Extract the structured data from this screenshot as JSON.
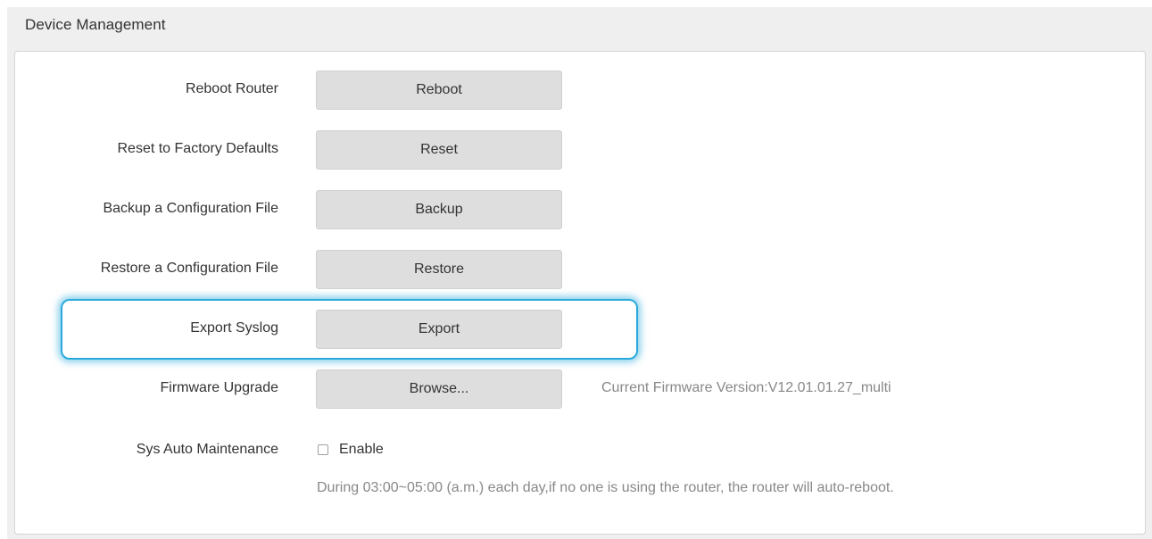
{
  "section": {
    "title": "Device Management"
  },
  "rows": {
    "reboot": {
      "label": "Reboot Router",
      "button": "Reboot"
    },
    "reset": {
      "label": "Reset to Factory Defaults",
      "button": "Reset"
    },
    "backup": {
      "label": "Backup a Configuration File",
      "button": "Backup"
    },
    "restore": {
      "label": "Restore a Configuration File",
      "button": "Restore"
    },
    "export": {
      "label": "Export Syslog",
      "button": "Export"
    },
    "firmware": {
      "label": "Firmware Upgrade",
      "button": "Browse...",
      "version_text": "Current Firmware Version:V12.01.01.27_multi"
    },
    "maintenance": {
      "label": "Sys Auto Maintenance",
      "checkbox_label": "Enable",
      "checked": false,
      "hint": "During 03:00~05:00 (a.m.) each day,if no one is using the router, the router will auto-reboot."
    }
  },
  "colors": {
    "highlight": "#2aa9dc",
    "button_bg": "#dedede",
    "muted_text": "#888888"
  }
}
